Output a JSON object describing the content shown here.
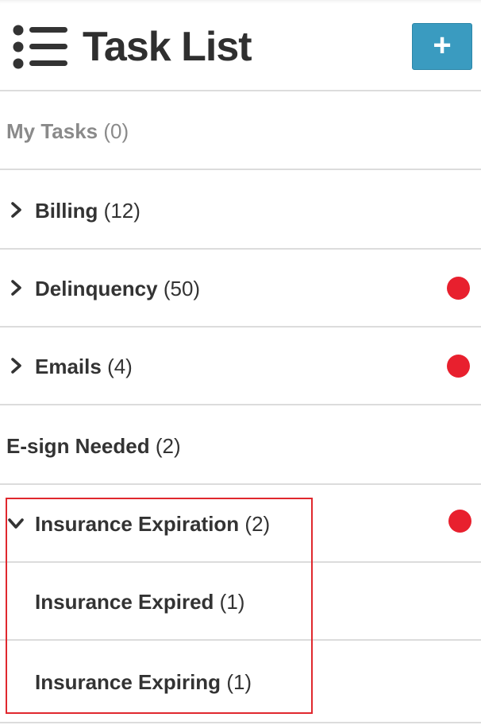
{
  "header": {
    "title": "Task List",
    "menu_icon": "list-icon",
    "add_button_icon": "plus-icon",
    "add_button_label": "+",
    "add_button_color": "#3a9bc0"
  },
  "status_color": "#e8202e",
  "highlight_color": "#e0282e",
  "tasks": [
    {
      "label": "My Tasks",
      "count": "(0)",
      "expandable": false,
      "expanded": false,
      "notification": false,
      "muted": true
    },
    {
      "label": "Billing",
      "count": "(12)",
      "expandable": true,
      "expanded": false,
      "notification": false
    },
    {
      "label": "Delinquency",
      "count": "(50)",
      "expandable": true,
      "expanded": false,
      "notification": true
    },
    {
      "label": "Emails",
      "count": "(4)",
      "expandable": true,
      "expanded": false,
      "notification": true
    },
    {
      "label": "E-sign Needed",
      "count": "(2)",
      "expandable": false,
      "expanded": false,
      "notification": false
    },
    {
      "label": "Insurance Expiration",
      "count": "(2)",
      "expandable": true,
      "expanded": true,
      "notification": true,
      "children": [
        {
          "label": "Insurance Expired",
          "count": "(1)"
        },
        {
          "label": "Insurance Expiring",
          "count": "(1)"
        }
      ]
    }
  ]
}
